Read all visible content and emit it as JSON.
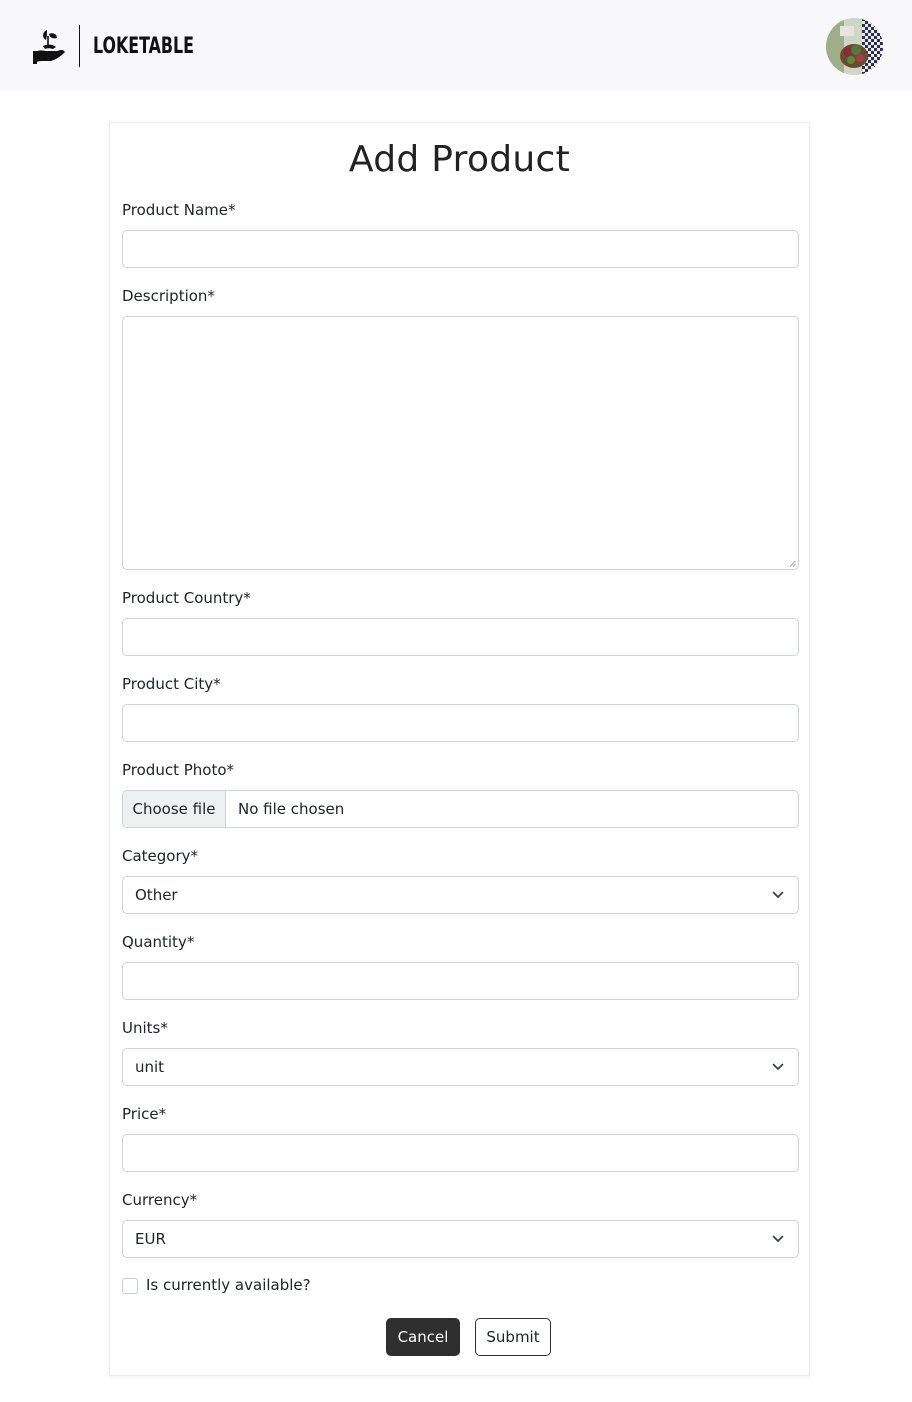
{
  "brand": {
    "name": "LOKETABLE",
    "icon": "hand-with-plant-logo"
  },
  "header": {
    "avatar": "user-avatar"
  },
  "form": {
    "title": "Add Product",
    "product_name": {
      "label": "Product Name*",
      "value": ""
    },
    "description": {
      "label": "Description*",
      "value": ""
    },
    "country": {
      "label": "Product Country*",
      "value": ""
    },
    "city": {
      "label": "Product City*",
      "value": ""
    },
    "photo": {
      "label": "Product Photo*",
      "button_label": "Choose file",
      "status": "No file chosen"
    },
    "category": {
      "label": "Category*",
      "selected": "Other"
    },
    "quantity": {
      "label": "Quantity*",
      "value": ""
    },
    "units": {
      "label": "Units*",
      "selected": "unit"
    },
    "price": {
      "label": "Price*",
      "value": ""
    },
    "currency": {
      "label": "Currency*",
      "selected": "EUR"
    },
    "available": {
      "label": "Is currently available?",
      "checked": false
    },
    "cancel_label": "Cancel",
    "submit_label": "Submit"
  },
  "colors": {
    "navbar_bg": "#f8f8fa",
    "primary_dark": "#2f2f2f",
    "border": "#ced4da"
  }
}
